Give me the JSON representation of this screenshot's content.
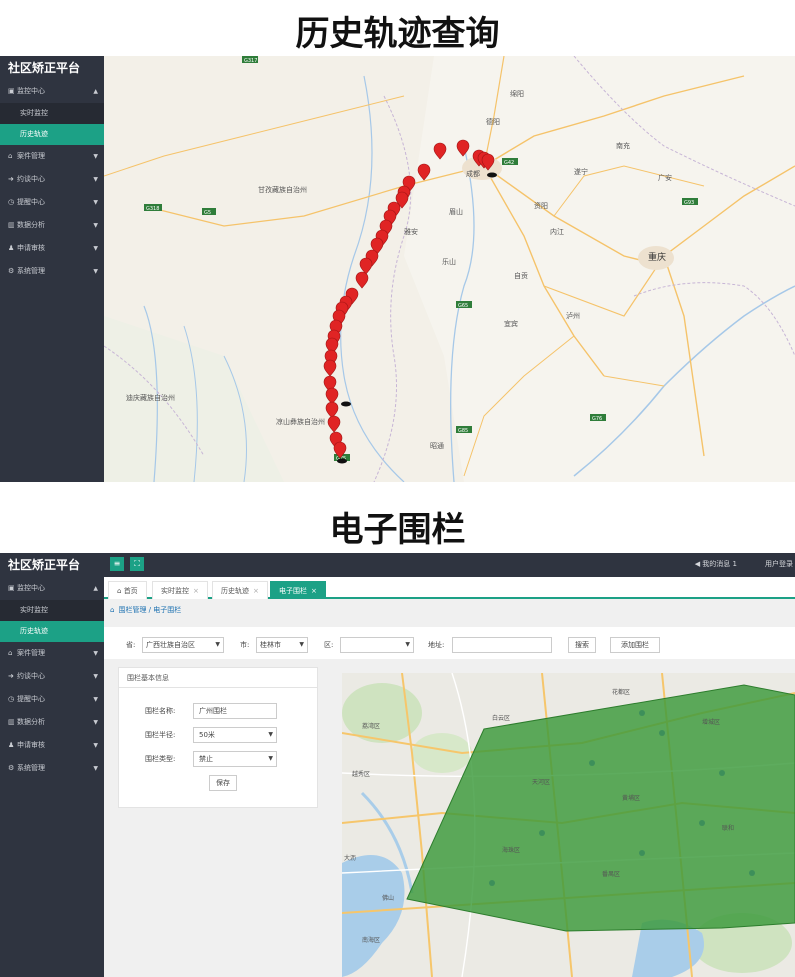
{
  "section_titles": {
    "history": "历史轨迹查询",
    "fence": "电子围栏"
  },
  "sidebar": {
    "brand": "社区矫正平台",
    "items": [
      {
        "label": "监控中心",
        "icon": "camera-icon",
        "expanded": true
      },
      {
        "label": "实时监控",
        "sub": true
      },
      {
        "label": "历史轨迹",
        "sub": true,
        "active": true
      },
      {
        "label": "案件管理",
        "icon": "bank-icon"
      },
      {
        "label": "约谈中心",
        "icon": "chat-icon"
      },
      {
        "label": "提醒中心",
        "icon": "clock-icon"
      },
      {
        "label": "数据分析",
        "icon": "chart-icon"
      },
      {
        "label": "申请审核",
        "icon": "user-icon"
      },
      {
        "label": "系统管理",
        "icon": "gear-icon"
      }
    ]
  },
  "map1": {
    "labels": {
      "ganzi": "甘孜藏族自治州",
      "diqing": "迪庆藏族自治州",
      "liangshan": "凉山彝族自治州",
      "chongqing": "重庆",
      "deyang": "德阳",
      "mianyang": "绵阳",
      "suining": "遂宁",
      "nanchong": "南充",
      "guangan": "广安",
      "meishan": "眉山",
      "leshan": "乐山",
      "zigong": "自贡",
      "luzhou": "泸州",
      "yibin": "宜宾",
      "chengdu": "成都",
      "ziyang": "资阳",
      "neijiang": "内江",
      "ya_an": "雅安",
      "zhaotong": "昭通"
    },
    "roads": [
      "G317",
      "G318",
      "G5",
      "G42",
      "G76",
      "G85",
      "G93",
      "G65",
      "G75"
    ]
  },
  "topbar": {
    "menu_icon": "menu-icon",
    "fullscreen_icon": "expand-icon",
    "notice": "◀ 我的消息 1",
    "user": "用户登录"
  },
  "tabs": [
    {
      "label": "首页",
      "icon": "home-icon"
    },
    {
      "label": "实时监控"
    },
    {
      "label": "历史轨迹"
    },
    {
      "label": "电子围栏",
      "active": true
    }
  ],
  "breadcrumb": "围栏管理 / 电子围栏",
  "filter": {
    "province_label": "省:",
    "province_value": "广西壮族自治区",
    "city_label": "市:",
    "city_value": "桂林市",
    "district_label": "区:",
    "district_value": "",
    "address_label": "地址:",
    "address_value": "",
    "search_button": "搜索",
    "add_button": "添加围栏"
  },
  "basic_info": {
    "header": "围栏基本信息",
    "name_label": "围栏名称:",
    "name_value": "广州围栏",
    "radius_label": "围栏半径:",
    "radius_value": "50米",
    "type_label": "围栏类型:",
    "type_value": "禁止",
    "save_button": "保存"
  },
  "map2": {
    "labels": {
      "baiyun": "白云区",
      "panyu": "番禺区",
      "huangpu": "黄埔区",
      "tianhe": "天河区",
      "yuexiu": "越秀区",
      "liwan": "荔湾区",
      "haizhu": "海珠区",
      "foshan": "佛山",
      "dali": "大沥",
      "nanhai": "南海区",
      "huadu": "花都区",
      "zengcheng": "增城区",
      "lianhe": "联和"
    }
  },
  "colors": {
    "sidebar_bg": "#2f3440",
    "accent": "#1ca186",
    "fence_fill": "#3a9a3a"
  }
}
